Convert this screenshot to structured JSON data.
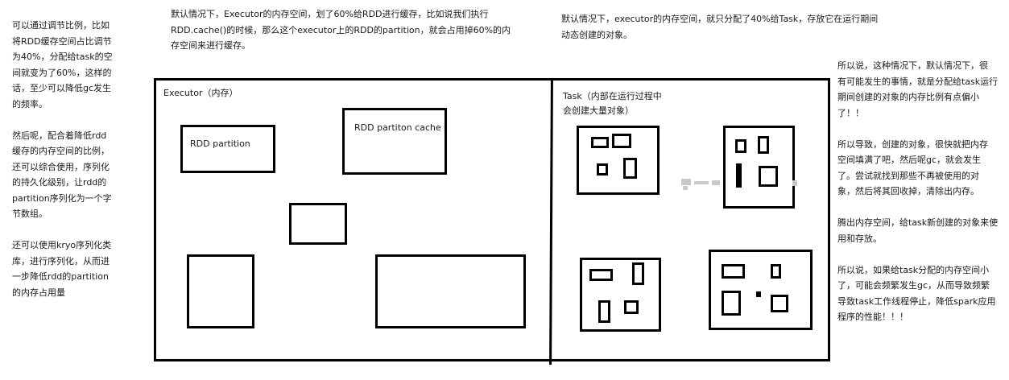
{
  "notes": {
    "left": "可以通过调节比例，比如\n将RDD缓存空间占比调节\n为40%，分配给task的空\n间就变为了60%，这样的\n话，至少可以降低gc发生\n的频率。\n\n然后呢，配合着降低rdd\n缓存的内存空间的比例，\n还可以综合使用，序列化\n的持久化级别，让rdd的\npartition序列化为一个字\n节数组。\n\n还可以使用kryo序列化类\n库，进行序列化，从而进\n一步降低rdd的partition\n的内存占用量",
    "top_middle": "默认情况下，Executor的内存空间，划了60%给RDD进行缓存，比如说我们执行\nRDD.cache()的时候，那么这个executor上的RDD的partition，就会占用掉60%的内\n存空间来进行缓存。",
    "top_right": "默认情况下，executor的内存空间，就只分配了40%给Task，存放它在运行期间\n动态创建的对象。",
    "right": "所以说，这种情况下，默认情况下，很\n有可能发生的事情，就是分配给task运行\n期间创建的对象的内存比例有点偏小\n了！！\n\n所以导致，创建的对象，很快就把内存\n空间填满了吧，然后呢gc，就会发生\n了。尝试就找到那些不再被使用的对\n象，然后将其回收掉，清除出内存。\n\n腾出内存空间，给task新创建的对象来使\n用和存放。\n\n所以说，如果给task分配的内存空间小\n了，可能会频繁发生gc，从而导致频繁\n导致task工作线程停止，降低spark应用\n程序的性能！！！"
  },
  "diagram": {
    "executor_label": "Executor（内存）",
    "rdd_partition_label": "RDD partition",
    "rdd_partition_cache_label": "RDD partiton cache",
    "task_label": "Task（内部在运行过程中\n会创建大量对象）"
  }
}
